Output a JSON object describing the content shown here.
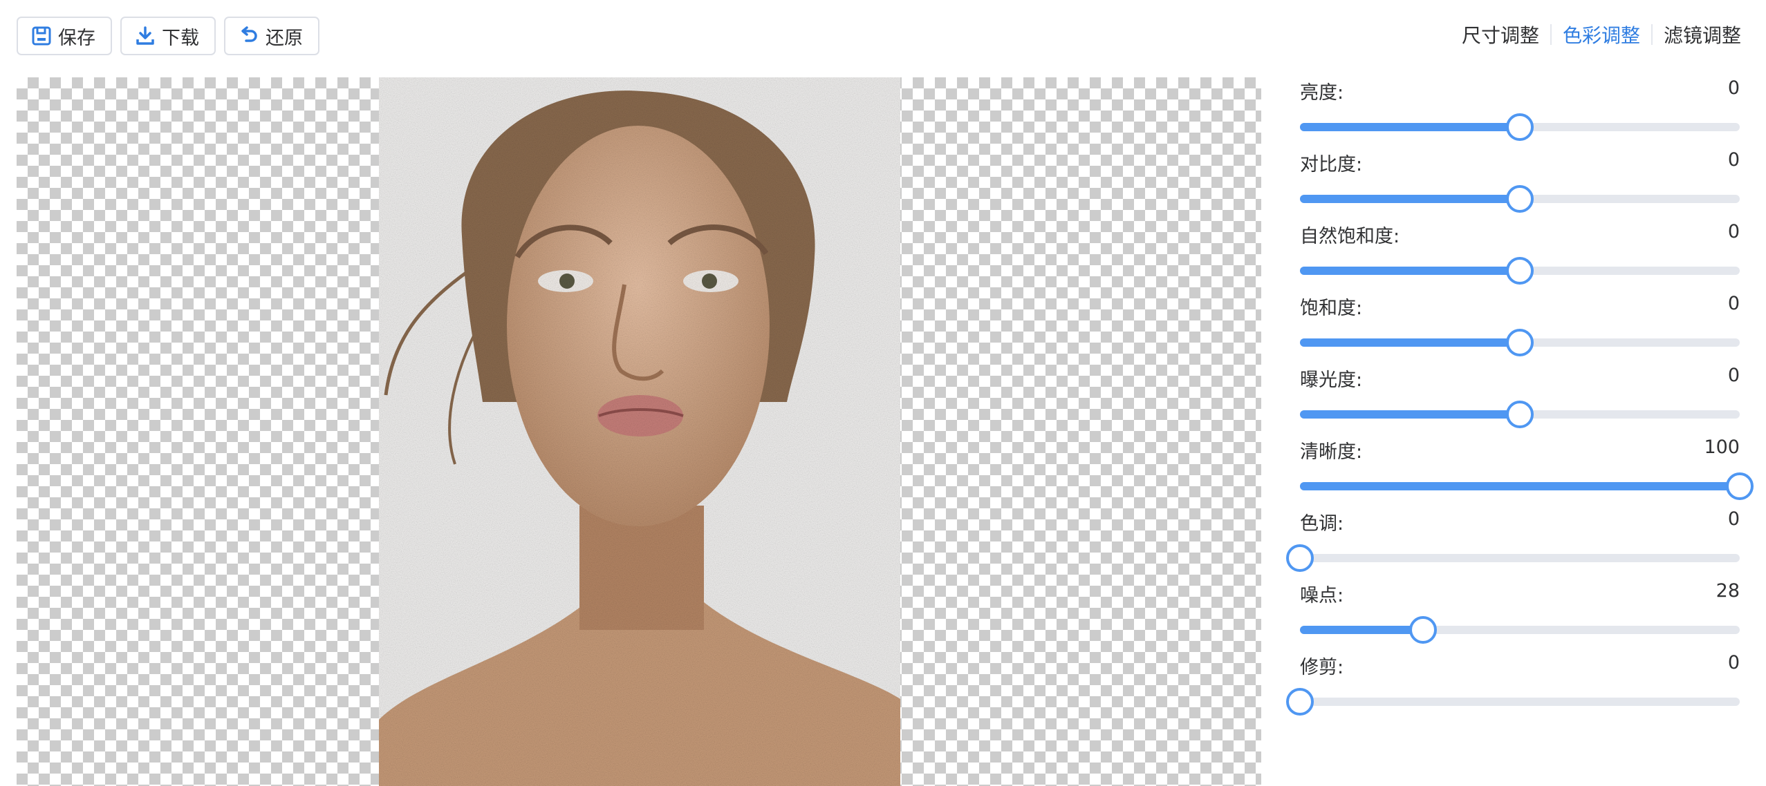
{
  "toolbar": {
    "save_label": "保存",
    "download_label": "下载",
    "restore_label": "还原",
    "save_icon": "floppy-disk-icon",
    "download_icon": "download-tray-icon",
    "restore_icon": "undo-arrow-icon"
  },
  "tabs": [
    {
      "label": "尺寸调整",
      "active": false
    },
    {
      "label": "色彩调整",
      "active": true
    },
    {
      "label": "滤镜调整",
      "active": false
    }
  ],
  "canvas": {
    "background": "transparency-checkerboard",
    "image_subject": "portrait of a woman with noise filter applied"
  },
  "sliders": [
    {
      "label": "亮度:",
      "value": "0",
      "fraction": 0.5
    },
    {
      "label": "对比度:",
      "value": "0",
      "fraction": 0.5
    },
    {
      "label": "自然饱和度:",
      "value": "0",
      "fraction": 0.5
    },
    {
      "label": "饱和度:",
      "value": "0",
      "fraction": 0.5
    },
    {
      "label": "曝光度:",
      "value": "0",
      "fraction": 0.5
    },
    {
      "label": "清晰度:",
      "value": "100",
      "fraction": 1.0
    },
    {
      "label": "色调:",
      "value": "0",
      "fraction": 0.0
    },
    {
      "label": "噪点:",
      "value": "28",
      "fraction": 0.28
    },
    {
      "label": "修剪:",
      "value": "0",
      "fraction": 0.0
    }
  ],
  "colors": {
    "accent": "#4f97f2",
    "active_tab": "#2f7de1",
    "track": "#e4e7ed"
  }
}
